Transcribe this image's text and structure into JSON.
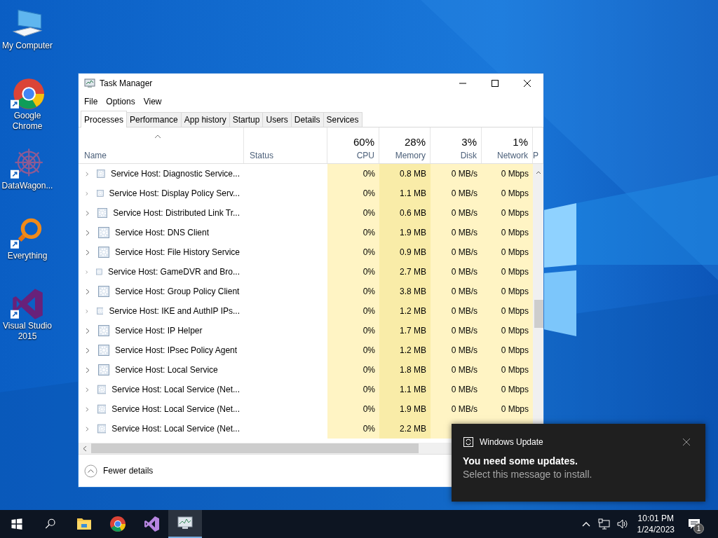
{
  "desktop_icons": [
    {
      "kind": "computer",
      "label": "My Computer"
    },
    {
      "kind": "chrome",
      "label": "Google Chrome"
    },
    {
      "kind": "datawagon",
      "label": "DataWagon..."
    },
    {
      "kind": "everything",
      "label": "Everything"
    },
    {
      "kind": "studio",
      "label": "Visual Studio 2015"
    }
  ],
  "window": {
    "title": "Task Manager",
    "menu": [
      "File",
      "Options",
      "View"
    ],
    "tabs": [
      {
        "label": "Processes",
        "selected": true
      },
      {
        "label": "Performance",
        "selected": false
      },
      {
        "label": "App history",
        "selected": false
      },
      {
        "label": "Startup",
        "selected": false
      },
      {
        "label": "Users",
        "selected": false
      },
      {
        "label": "Details",
        "selected": false
      },
      {
        "label": "Services",
        "selected": false
      }
    ],
    "columns": [
      {
        "label": "Name"
      },
      {
        "label": "Status"
      },
      {
        "percent": "60%",
        "label": "CPU"
      },
      {
        "percent": "28%",
        "label": "Memory"
      },
      {
        "percent": "3%",
        "label": "Disk"
      },
      {
        "percent": "1%",
        "label": "Network"
      },
      {
        "label": "P"
      }
    ],
    "rows": [
      {
        "name": "Service Host: Diagnostic Service...",
        "cpu": "0%",
        "memory": "0.8 MB",
        "disk": "0 MB/s",
        "network": "0 Mbps"
      },
      {
        "name": "Service Host: Display Policy Serv...",
        "cpu": "0%",
        "memory": "1.1 MB",
        "disk": "0 MB/s",
        "network": "0 Mbps"
      },
      {
        "name": "Service Host: Distributed Link Tr...",
        "cpu": "0%",
        "memory": "0.6 MB",
        "disk": "0 MB/s",
        "network": "0 Mbps"
      },
      {
        "name": "Service Host: DNS Client",
        "cpu": "0%",
        "memory": "1.9 MB",
        "disk": "0 MB/s",
        "network": "0 Mbps"
      },
      {
        "name": "Service Host: File History Service",
        "cpu": "0%",
        "memory": "0.9 MB",
        "disk": "0 MB/s",
        "network": "0 Mbps"
      },
      {
        "name": "Service Host: GameDVR and Bro...",
        "cpu": "0%",
        "memory": "2.7 MB",
        "disk": "0 MB/s",
        "network": "0 Mbps"
      },
      {
        "name": "Service Host: Group Policy Client",
        "cpu": "0%",
        "memory": "3.8 MB",
        "disk": "0 MB/s",
        "network": "0 Mbps"
      },
      {
        "name": "Service Host: IKE and AuthIP IPs...",
        "cpu": "0%",
        "memory": "1.2 MB",
        "disk": "0 MB/s",
        "network": "0 Mbps"
      },
      {
        "name": "Service Host: IP Helper",
        "cpu": "0%",
        "memory": "1.7 MB",
        "disk": "0 MB/s",
        "network": "0 Mbps"
      },
      {
        "name": "Service Host: IPsec Policy Agent",
        "cpu": "0%",
        "memory": "1.2 MB",
        "disk": "0 MB/s",
        "network": "0 Mbps"
      },
      {
        "name": "Service Host: Local Service",
        "cpu": "0%",
        "memory": "1.8 MB",
        "disk": "0 MB/s",
        "network": "0 Mbps"
      },
      {
        "name": "Service Host: Local Service (Net...",
        "cpu": "0%",
        "memory": "1.1 MB",
        "disk": "0 MB/s",
        "network": "0 Mbps"
      },
      {
        "name": "Service Host: Local Service (Net...",
        "cpu": "0%",
        "memory": "1.9 MB",
        "disk": "0 MB/s",
        "network": "0 Mbps"
      },
      {
        "name": "Service Host: Local Service (Net...",
        "cpu": "0%",
        "memory": "2.2 MB"
      }
    ],
    "footer": "Fewer details"
  },
  "toast": {
    "app": "Windows Update",
    "title": "You need some updates.",
    "body": "Select this message to install."
  },
  "taskbar": {
    "apps": [
      {
        "kind": "explorer",
        "selected": false
      },
      {
        "kind": "chrome",
        "selected": false
      },
      {
        "kind": "studio",
        "selected": false
      },
      {
        "kind": "taskmgr",
        "selected": true
      }
    ],
    "time": "10:01 PM",
    "date": "1/24/2023",
    "notification_count": "1"
  }
}
